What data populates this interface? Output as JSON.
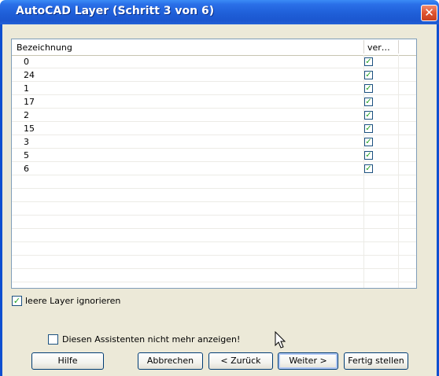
{
  "window": {
    "title": "AutoCAD Layer (Schritt 3 von 6)",
    "close_glyph": "✕"
  },
  "list": {
    "columns": [
      "Bezeichnung",
      "ver…"
    ],
    "rows": [
      {
        "name": "0",
        "checked": true
      },
      {
        "name": "24",
        "checked": true
      },
      {
        "name": "1",
        "checked": true
      },
      {
        "name": "17",
        "checked": true
      },
      {
        "name": "2",
        "checked": true
      },
      {
        "name": "15",
        "checked": true
      },
      {
        "name": "3",
        "checked": true
      },
      {
        "name": "5",
        "checked": true
      },
      {
        "name": "6",
        "checked": true
      }
    ],
    "empty_rows": 8
  },
  "options": {
    "leere_layer_label": "leere Layer ignorieren",
    "leere_layer_checked": true,
    "assistant_label": "Diesen Assistenten nicht mehr anzeigen!",
    "assistant_checked": false
  },
  "buttons": {
    "hilfe": "Hilfe",
    "abbrechen": "Abbrechen",
    "zurueck": "< Zurück",
    "weiter": "Weiter >",
    "fertig": "Fertig stellen"
  },
  "icons": {
    "check": "✓",
    "close": "close-icon",
    "cursor": "mouse-pointer-icon"
  },
  "colors": {
    "titlebar": "#1f5fd8",
    "dialog_bg": "#ece9d8",
    "checkmark": "#21a121"
  }
}
